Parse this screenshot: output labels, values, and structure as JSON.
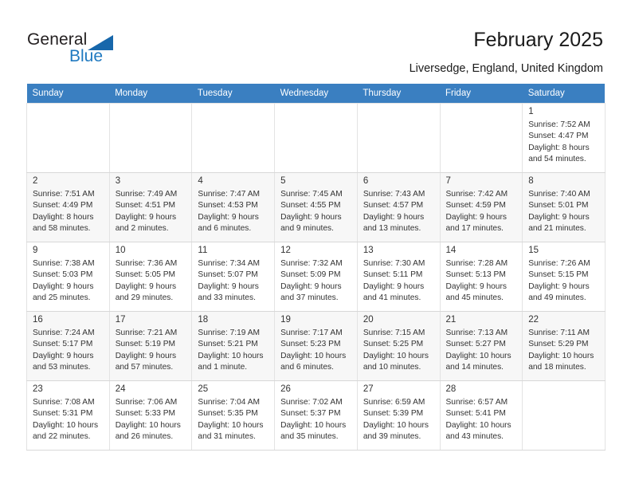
{
  "brand": {
    "word1": "General",
    "word2": "Blue",
    "triangle_color": "#1767ab",
    "blue_color": "#1f79c0"
  },
  "header": {
    "title": "February 2025",
    "subtitle": "Liversedge, England, United Kingdom"
  },
  "theme": {
    "header_row_bg": "#3a7fc1",
    "header_row_text": "#ffffff",
    "grid_line": "#e3e3e3",
    "empty_cell_bg": "#f4f4f4",
    "alt_row_bg": "#f7f7f7"
  },
  "weekday_headers": [
    "Sunday",
    "Monday",
    "Tuesday",
    "Wednesday",
    "Thursday",
    "Friday",
    "Saturday"
  ],
  "weeks": [
    [
      {
        "day": "",
        "info": ""
      },
      {
        "day": "",
        "info": ""
      },
      {
        "day": "",
        "info": ""
      },
      {
        "day": "",
        "info": ""
      },
      {
        "day": "",
        "info": ""
      },
      {
        "day": "",
        "info": ""
      },
      {
        "day": "1",
        "info": "Sunrise: 7:52 AM\nSunset: 4:47 PM\nDaylight: 8 hours\nand 54 minutes."
      }
    ],
    [
      {
        "day": "2",
        "info": "Sunrise: 7:51 AM\nSunset: 4:49 PM\nDaylight: 8 hours\nand 58 minutes."
      },
      {
        "day": "3",
        "info": "Sunrise: 7:49 AM\nSunset: 4:51 PM\nDaylight: 9 hours\nand 2 minutes."
      },
      {
        "day": "4",
        "info": "Sunrise: 7:47 AM\nSunset: 4:53 PM\nDaylight: 9 hours\nand 6 minutes."
      },
      {
        "day": "5",
        "info": "Sunrise: 7:45 AM\nSunset: 4:55 PM\nDaylight: 9 hours\nand 9 minutes."
      },
      {
        "day": "6",
        "info": "Sunrise: 7:43 AM\nSunset: 4:57 PM\nDaylight: 9 hours\nand 13 minutes."
      },
      {
        "day": "7",
        "info": "Sunrise: 7:42 AM\nSunset: 4:59 PM\nDaylight: 9 hours\nand 17 minutes."
      },
      {
        "day": "8",
        "info": "Sunrise: 7:40 AM\nSunset: 5:01 PM\nDaylight: 9 hours\nand 21 minutes."
      }
    ],
    [
      {
        "day": "9",
        "info": "Sunrise: 7:38 AM\nSunset: 5:03 PM\nDaylight: 9 hours\nand 25 minutes."
      },
      {
        "day": "10",
        "info": "Sunrise: 7:36 AM\nSunset: 5:05 PM\nDaylight: 9 hours\nand 29 minutes."
      },
      {
        "day": "11",
        "info": "Sunrise: 7:34 AM\nSunset: 5:07 PM\nDaylight: 9 hours\nand 33 minutes."
      },
      {
        "day": "12",
        "info": "Sunrise: 7:32 AM\nSunset: 5:09 PM\nDaylight: 9 hours\nand 37 minutes."
      },
      {
        "day": "13",
        "info": "Sunrise: 7:30 AM\nSunset: 5:11 PM\nDaylight: 9 hours\nand 41 minutes."
      },
      {
        "day": "14",
        "info": "Sunrise: 7:28 AM\nSunset: 5:13 PM\nDaylight: 9 hours\nand 45 minutes."
      },
      {
        "day": "15",
        "info": "Sunrise: 7:26 AM\nSunset: 5:15 PM\nDaylight: 9 hours\nand 49 minutes."
      }
    ],
    [
      {
        "day": "16",
        "info": "Sunrise: 7:24 AM\nSunset: 5:17 PM\nDaylight: 9 hours\nand 53 minutes."
      },
      {
        "day": "17",
        "info": "Sunrise: 7:21 AM\nSunset: 5:19 PM\nDaylight: 9 hours\nand 57 minutes."
      },
      {
        "day": "18",
        "info": "Sunrise: 7:19 AM\nSunset: 5:21 PM\nDaylight: 10 hours\nand 1 minute."
      },
      {
        "day": "19",
        "info": "Sunrise: 7:17 AM\nSunset: 5:23 PM\nDaylight: 10 hours\nand 6 minutes."
      },
      {
        "day": "20",
        "info": "Sunrise: 7:15 AM\nSunset: 5:25 PM\nDaylight: 10 hours\nand 10 minutes."
      },
      {
        "day": "21",
        "info": "Sunrise: 7:13 AM\nSunset: 5:27 PM\nDaylight: 10 hours\nand 14 minutes."
      },
      {
        "day": "22",
        "info": "Sunrise: 7:11 AM\nSunset: 5:29 PM\nDaylight: 10 hours\nand 18 minutes."
      }
    ],
    [
      {
        "day": "23",
        "info": "Sunrise: 7:08 AM\nSunset: 5:31 PM\nDaylight: 10 hours\nand 22 minutes."
      },
      {
        "day": "24",
        "info": "Sunrise: 7:06 AM\nSunset: 5:33 PM\nDaylight: 10 hours\nand 26 minutes."
      },
      {
        "day": "25",
        "info": "Sunrise: 7:04 AM\nSunset: 5:35 PM\nDaylight: 10 hours\nand 31 minutes."
      },
      {
        "day": "26",
        "info": "Sunrise: 7:02 AM\nSunset: 5:37 PM\nDaylight: 10 hours\nand 35 minutes."
      },
      {
        "day": "27",
        "info": "Sunrise: 6:59 AM\nSunset: 5:39 PM\nDaylight: 10 hours\nand 39 minutes."
      },
      {
        "day": "28",
        "info": "Sunrise: 6:57 AM\nSunset: 5:41 PM\nDaylight: 10 hours\nand 43 minutes."
      },
      {
        "day": "",
        "info": ""
      }
    ]
  ]
}
